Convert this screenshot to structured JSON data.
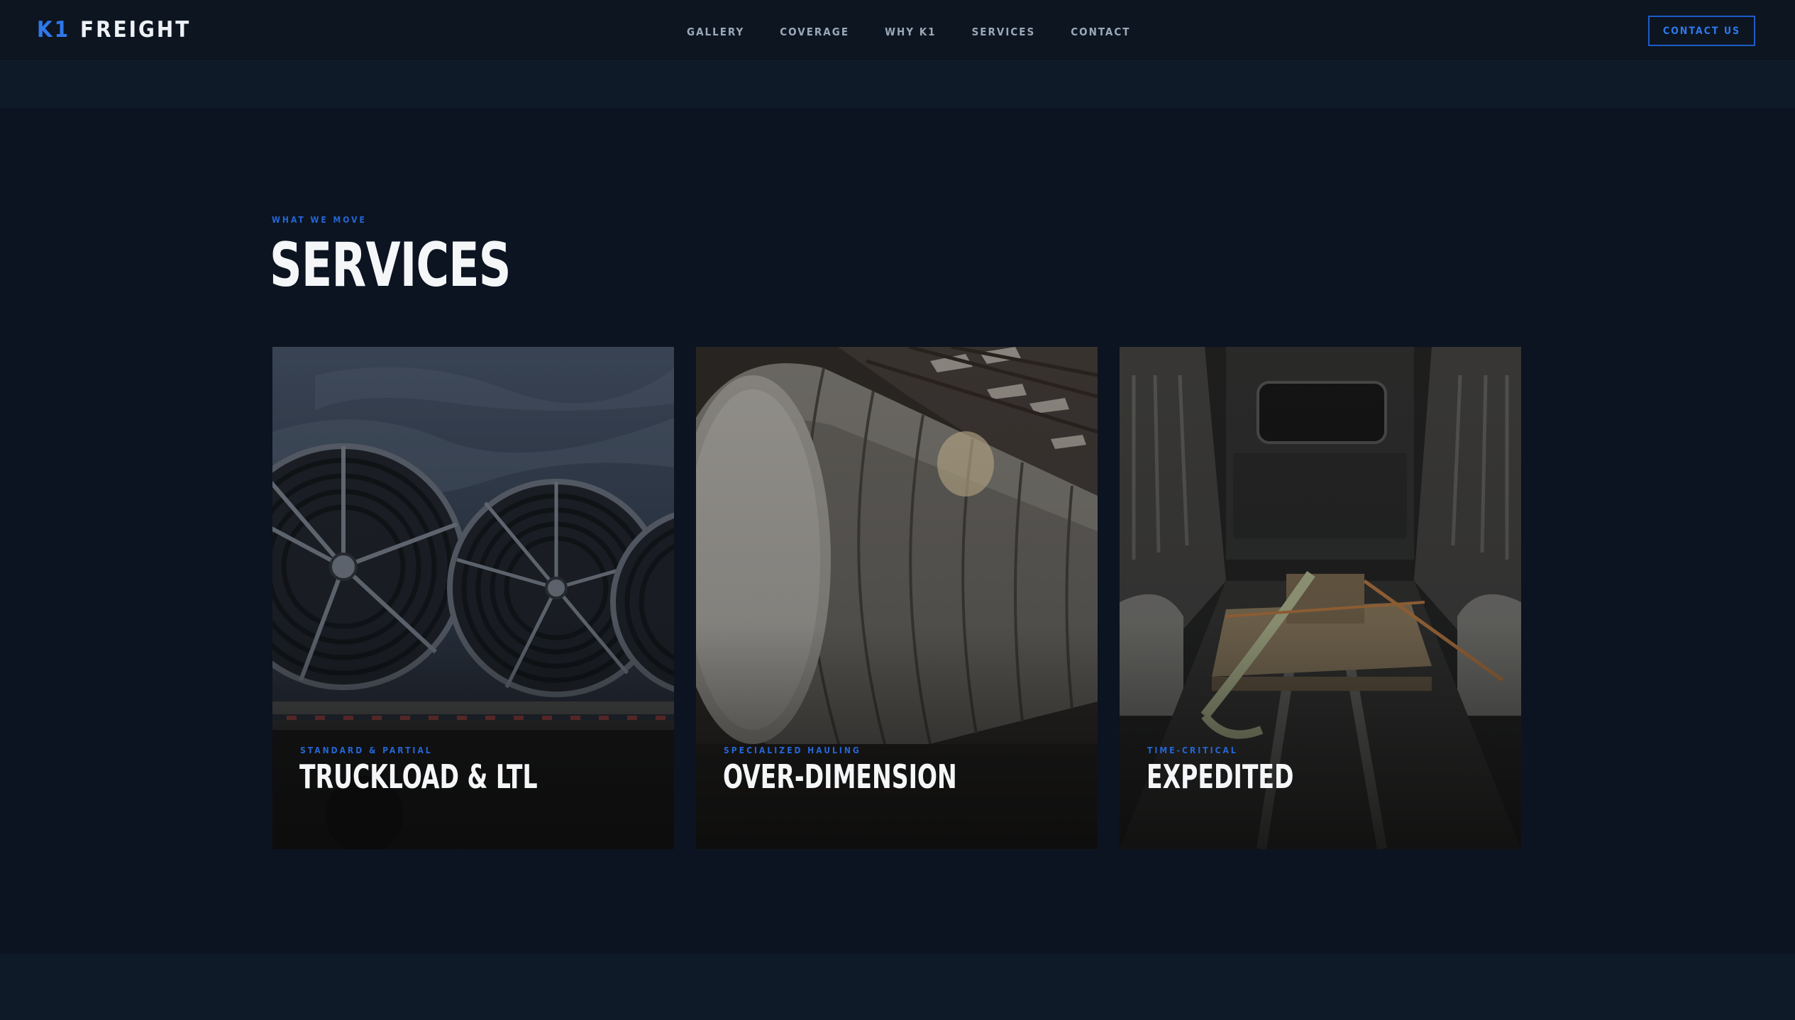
{
  "brand": {
    "prefix": "K1",
    "name": "FREIGHT",
    "accent_color": "#2f78ea"
  },
  "nav": {
    "items": [
      {
        "label": "GALLERY"
      },
      {
        "label": "COVERAGE"
      },
      {
        "label": "WHY K1"
      },
      {
        "label": "SERVICES"
      },
      {
        "label": "CONTACT"
      }
    ],
    "cta_label": "CONTACT US"
  },
  "services": {
    "eyebrow": "WHAT WE MOVE",
    "title": "SERVICES",
    "cards": [
      {
        "tag": "STANDARD & PARTIAL",
        "title": "TRUCKLOAD & LTL",
        "image": "reels-of-pipe-on-flatbed"
      },
      {
        "tag": "SPECIALIZED HAULING",
        "title": "OVER-DIMENSION",
        "image": "large-tank-in-warehouse"
      },
      {
        "tag": "TIME-CRITICAL",
        "title": "EXPEDITED",
        "image": "pallet-strapped-in-cargo-van"
      }
    ]
  },
  "colors": {
    "background": "#0b1420",
    "band": "#0f1a28",
    "accent": "#2466d6",
    "title": "#f4f6f8"
  }
}
